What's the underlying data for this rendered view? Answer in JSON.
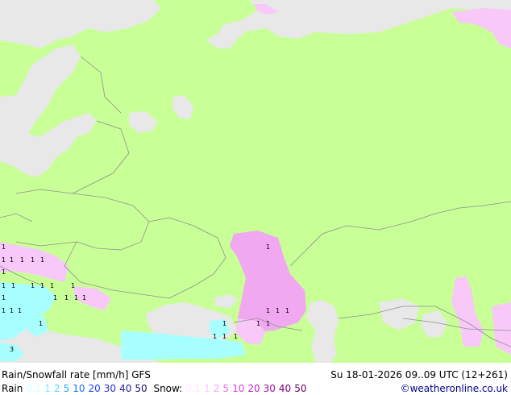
{
  "title": "Rain/Snowfall rate [mm/h] GFS",
  "datetime": "Su 18-01-2026 09..09 UTC (12+261)",
  "credit": "©weatheronline.co.uk",
  "legend": {
    "rain_label": "Rain",
    "snow_label": "Snow:",
    "rain_values": [
      {
        "text": "0.1",
        "color": "#d8ffff"
      },
      {
        "text": "1",
        "color": "#7fe9ff"
      },
      {
        "text": "2",
        "color": "#53d3ff"
      },
      {
        "text": "5",
        "color": "#1ea7ff"
      },
      {
        "text": "10",
        "color": "#1c6cff"
      },
      {
        "text": "20",
        "color": "#1c3fff"
      },
      {
        "text": "30",
        "color": "#222fc8"
      },
      {
        "text": "40",
        "color": "#232096"
      },
      {
        "text": "50",
        "color": "#1d1264"
      }
    ],
    "snow_values": [
      {
        "text": "0.1",
        "color": "#ffe8ff"
      },
      {
        "text": "1",
        "color": "#ffc8ff"
      },
      {
        "text": "2",
        "color": "#f7a0f7"
      },
      {
        "text": "5",
        "color": "#ef70ef"
      },
      {
        "text": "10",
        "color": "#e040e0"
      },
      {
        "text": "20",
        "color": "#c020c0"
      },
      {
        "text": "30",
        "color": "#9c0f9c"
      },
      {
        "text": "40",
        "color": "#800080"
      },
      {
        "text": "50",
        "color": "#640064"
      }
    ]
  },
  "map": {
    "land_color": "#c8ff96",
    "sea_color": "#e8e8e8",
    "snow_light_color": "#f8c8f8",
    "snow_medium_color": "#f0a8f0",
    "rain_light_color": "#a8ffff",
    "border_color": "#909090",
    "value_labels": [
      "1",
      "1",
      "1",
      "1",
      "1",
      "1",
      "1",
      "1",
      "1",
      "1",
      "1",
      "1",
      "1",
      "1",
      "1",
      "1",
      "1",
      "1",
      "1",
      "1",
      "1",
      "1",
      "1",
      "1",
      "1",
      "1",
      "1",
      "1",
      "1",
      "1",
      "1",
      "1",
      "1",
      "1",
      "1",
      "1",
      "3"
    ]
  }
}
